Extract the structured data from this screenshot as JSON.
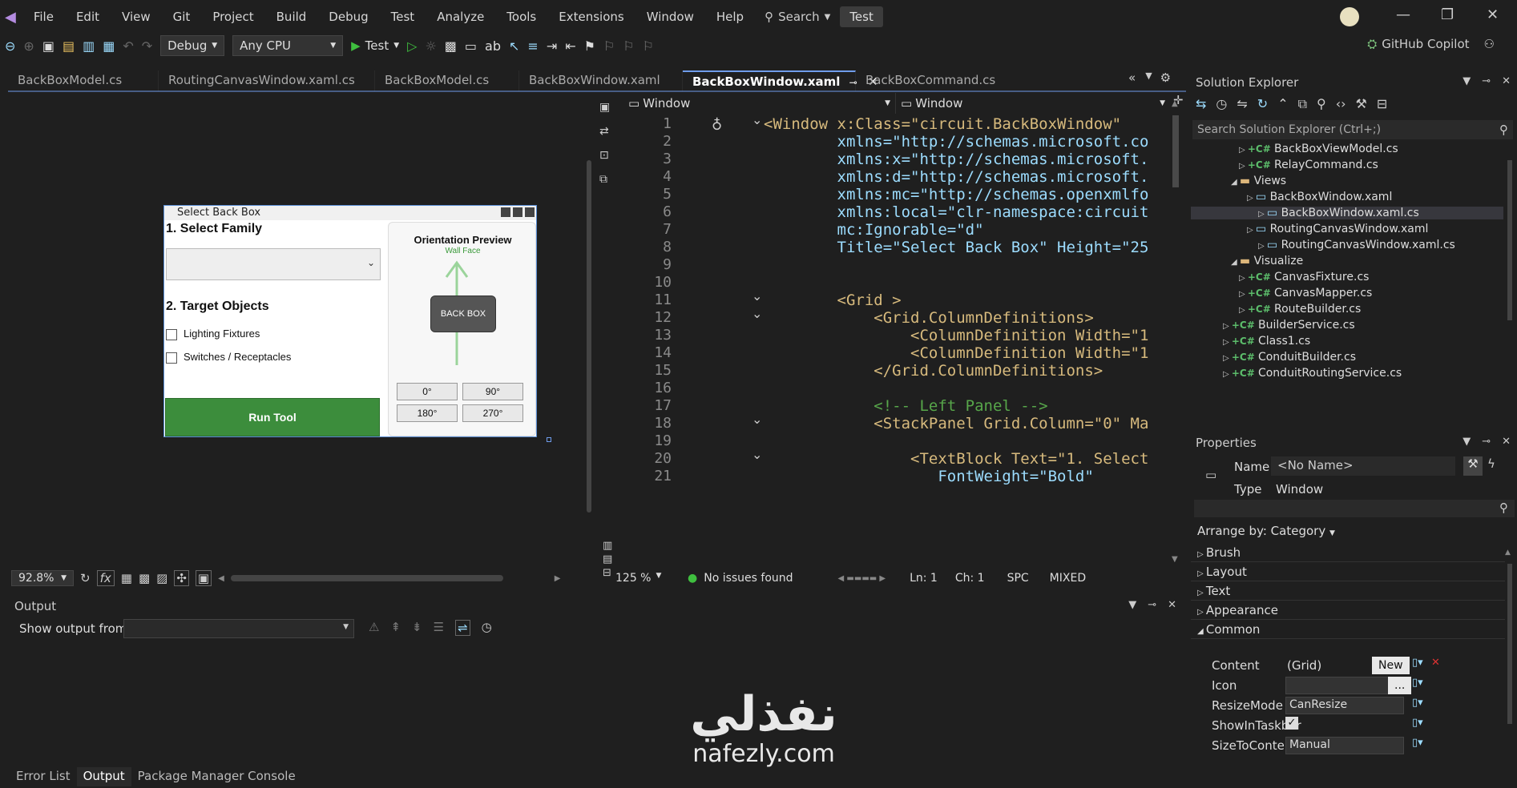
{
  "menu": [
    "File",
    "Edit",
    "View",
    "Git",
    "Project",
    "Build",
    "Debug",
    "Test",
    "Analyze",
    "Tools",
    "Extensions",
    "Window",
    "Help"
  ],
  "search_label": "Search",
  "test_pill": "Test",
  "toolbar": {
    "config": "Debug",
    "platform": "Any CPU",
    "run_label": "Test",
    "copilot": "GitHub Copilot"
  },
  "tabs": [
    "BackBoxModel.cs",
    "RoutingCanvasWindow.xaml.cs",
    "BackBoxModel.cs",
    "BackBoxWindow.xaml",
    "BackBoxWindow.xaml",
    "BackBoxCommand.cs"
  ],
  "active_tab_index": 4,
  "designer": {
    "zoom": "92.8%",
    "dialog": {
      "title": "Select Back Box",
      "family_heading": "1. Select Family",
      "target_heading": "2. Target Objects",
      "check1": "Lighting Fixtures",
      "check2": "Switches / Receptacles",
      "run_button": "Run Tool",
      "preview_title": "Orientation Preview",
      "wall_face": "Wall Face",
      "back_box": "BACK BOX",
      "angles": [
        "0°",
        "90°",
        "180°",
        "270°"
      ]
    }
  },
  "editor": {
    "scope_left": "Window",
    "scope_right": "Window",
    "zoom": "125 %",
    "status": "No issues found",
    "ln": "Ln: 1",
    "ch": "Ch: 1",
    "spc": "SPC",
    "mixed": "MIXED",
    "lines": [
      {
        "n": "1",
        "text": "<Window x:Class=\"circuit.BackBoxWindow\""
      },
      {
        "n": "2",
        "text": "        xmlns=\"http://schemas.microsoft.co"
      },
      {
        "n": "3",
        "text": "        xmlns:x=\"http://schemas.microsoft."
      },
      {
        "n": "4",
        "text": "        xmlns:d=\"http://schemas.microsoft."
      },
      {
        "n": "5",
        "text": "        xmlns:mc=\"http://schemas.openxmlfo"
      },
      {
        "n": "6",
        "text": "        xmlns:local=\"clr-namespace:circuit"
      },
      {
        "n": "7",
        "text": "        mc:Ignorable=\"d\""
      },
      {
        "n": "8",
        "text": "        Title=\"Select Back Box\" Height=\"25"
      },
      {
        "n": "9",
        "text": ""
      },
      {
        "n": "10",
        "text": ""
      },
      {
        "n": "11",
        "text": "        <Grid >"
      },
      {
        "n": "12",
        "text": "            <Grid.ColumnDefinitions>"
      },
      {
        "n": "13",
        "text": "                <ColumnDefinition Width=\"1"
      },
      {
        "n": "14",
        "text": "                <ColumnDefinition Width=\"1"
      },
      {
        "n": "15",
        "text": "            </Grid.ColumnDefinitions>"
      },
      {
        "n": "16",
        "text": ""
      },
      {
        "n": "17",
        "text": "            <!-- Left Panel -->"
      },
      {
        "n": "18",
        "text": "            <StackPanel Grid.Column=\"0\" Ma"
      },
      {
        "n": "19",
        "text": ""
      },
      {
        "n": "20",
        "text": "                <TextBlock Text=\"1. Select"
      },
      {
        "n": "21",
        "text": "                   FontWeight=\"Bold\""
      }
    ]
  },
  "solution": {
    "title": "Solution Explorer",
    "search": "Search Solution Explorer (Ctrl+;)",
    "items": [
      {
        "label": "BackBoxViewModel.cs"
      },
      {
        "label": "RelayCommand.cs"
      },
      {
        "label": "Views"
      },
      {
        "label": "BackBoxWindow.xaml"
      },
      {
        "label": "BackBoxWindow.xaml.cs"
      },
      {
        "label": "RoutingCanvasWindow.xaml"
      },
      {
        "label": "RoutingCanvasWindow.xaml.cs"
      },
      {
        "label": "Visualize"
      },
      {
        "label": "CanvasFixture.cs"
      },
      {
        "label": "CanvasMapper.cs"
      },
      {
        "label": "RouteBuilder.cs"
      },
      {
        "label": "BuilderService.cs"
      },
      {
        "label": "Class1.cs"
      },
      {
        "label": "ConduitBuilder.cs"
      },
      {
        "label": "ConduitRoutingService.cs"
      }
    ]
  },
  "properties": {
    "title": "Properties",
    "name_label": "Name",
    "name_value": "<No Name>",
    "type_label": "Type",
    "type_value": "Window",
    "arrange": "Arrange by: Category",
    "categories": [
      "Brush",
      "Layout",
      "Text",
      "Appearance",
      "Common"
    ],
    "rows": [
      {
        "label": "Content",
        "value": "(Grid)",
        "button": "New"
      },
      {
        "label": "Icon",
        "value": "",
        "button": "..."
      },
      {
        "label": "ResizeMode",
        "value": "CanResize"
      },
      {
        "label": "ShowInTaskbar",
        "value": "✓"
      },
      {
        "label": "SizeToContent",
        "value": "Manual"
      }
    ]
  },
  "output": {
    "title": "Output",
    "show_from": "Show output from:",
    "tabs": [
      "Error List",
      "Output",
      "Package Manager Console"
    ]
  },
  "watermark": {
    "arabic": "نفذلي",
    "latin": "nafezly.com"
  },
  "colors": {
    "accent": "#6f9ceb",
    "run_green": "#3c8d3c",
    "panel": "#1f1f1f"
  }
}
